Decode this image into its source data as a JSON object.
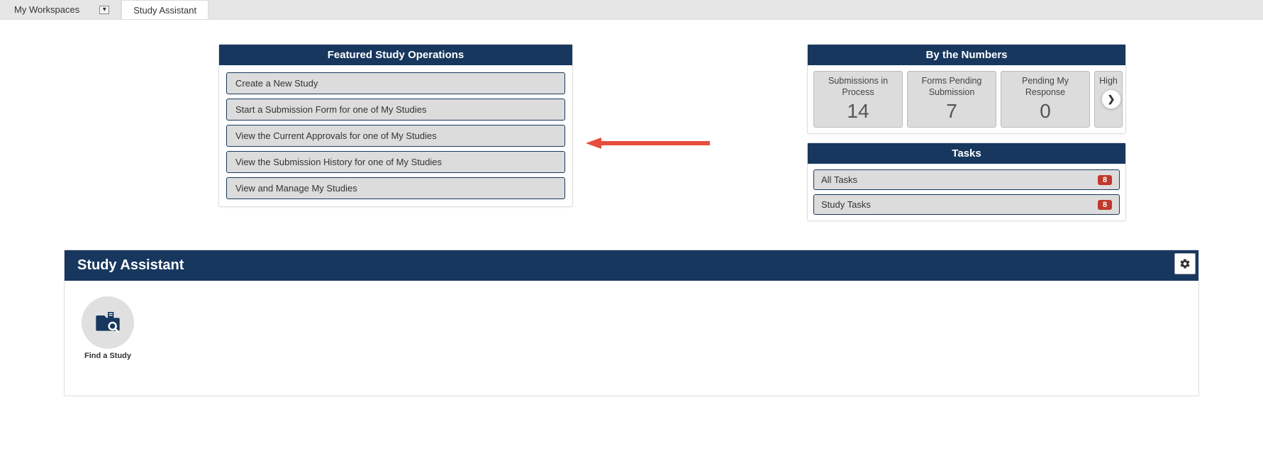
{
  "tabs": {
    "myWorkspaces": "My Workspaces",
    "studyAssistant": "Study Assistant"
  },
  "featured": {
    "title": "Featured Study Operations",
    "ops": [
      "Create a New Study",
      "Start a Submission Form for one of My Studies",
      "View the Current Approvals for one of My Studies",
      "View the Submission History for one of My Studies",
      "View and Manage My Studies"
    ]
  },
  "numbers": {
    "title": "By the Numbers",
    "cards": [
      {
        "label": "Submissions in Process",
        "value": "14"
      },
      {
        "label": "Forms Pending Submission",
        "value": "7"
      },
      {
        "label": "Pending My Response",
        "value": "0"
      },
      {
        "label": "High",
        "value": ""
      }
    ]
  },
  "tasks": {
    "title": "Tasks",
    "rows": [
      {
        "label": "All Tasks",
        "count": "8"
      },
      {
        "label": "Study Tasks",
        "count": "8"
      }
    ]
  },
  "section": {
    "title": "Study Assistant",
    "tiles": [
      {
        "label": "Find a Study"
      }
    ]
  }
}
